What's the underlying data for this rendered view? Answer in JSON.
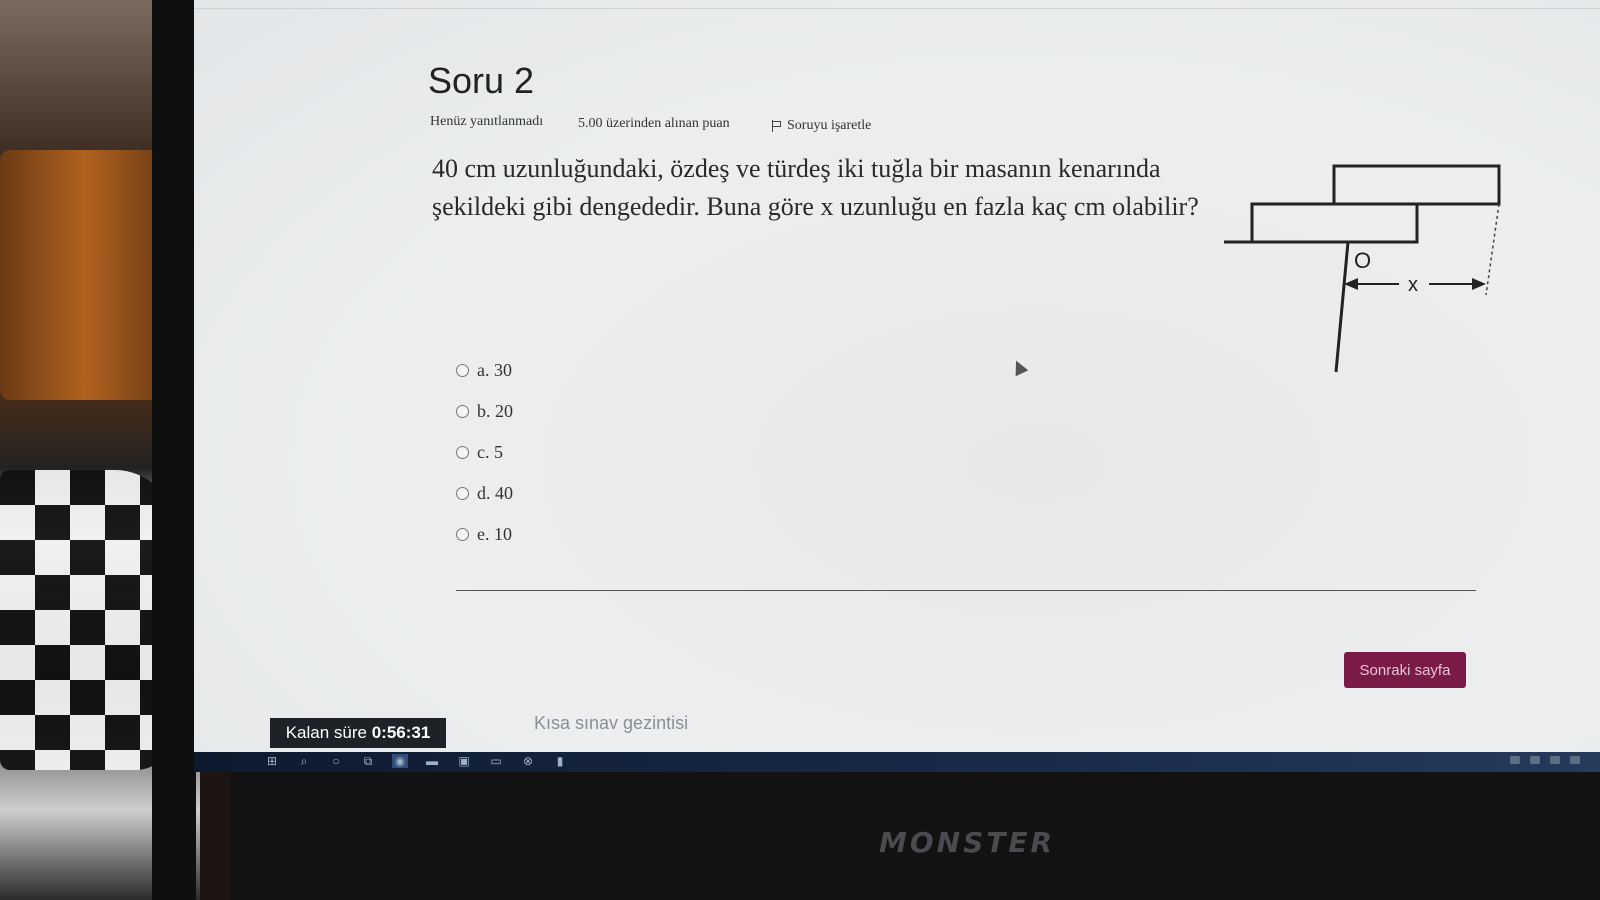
{
  "question": {
    "title": "Soru 2",
    "status": "Henüz yanıtlanmadı",
    "points": "5.00 üzerinden alınan puan",
    "flag_label": "Soruyu işaretle",
    "text": "40 cm uzunluğundaki, özdeş ve türdeş iki tuğla bir masanın kenarında şekildeki gibi dengededir. Buna göre x uzunluğu en fazla kaç cm olabilir?",
    "figure": {
      "point_label": "O",
      "length_label": "x"
    }
  },
  "answers": [
    {
      "label": "a. 30"
    },
    {
      "label": "b. 20"
    },
    {
      "label": "c. 5"
    },
    {
      "label": "d. 40"
    },
    {
      "label": "e. 10"
    }
  ],
  "navigation": {
    "next_button": "Sonraki sayfa",
    "quiz_nav_link": "Kısa sınav gezintisi"
  },
  "timer": {
    "label": "Kalan süre",
    "value": "0:56:31"
  },
  "taskbar": {
    "icons": [
      "windows-icon",
      "search-icon",
      "cortana-icon",
      "task-view-icon",
      "browser-icon",
      "folder-icon",
      "store-icon",
      "mail-icon",
      "xbox-icon",
      "office-icon"
    ]
  },
  "brand": "MONSTER",
  "colors": {
    "accent": "#7a1a47",
    "timer_bg": "#1e2226"
  }
}
